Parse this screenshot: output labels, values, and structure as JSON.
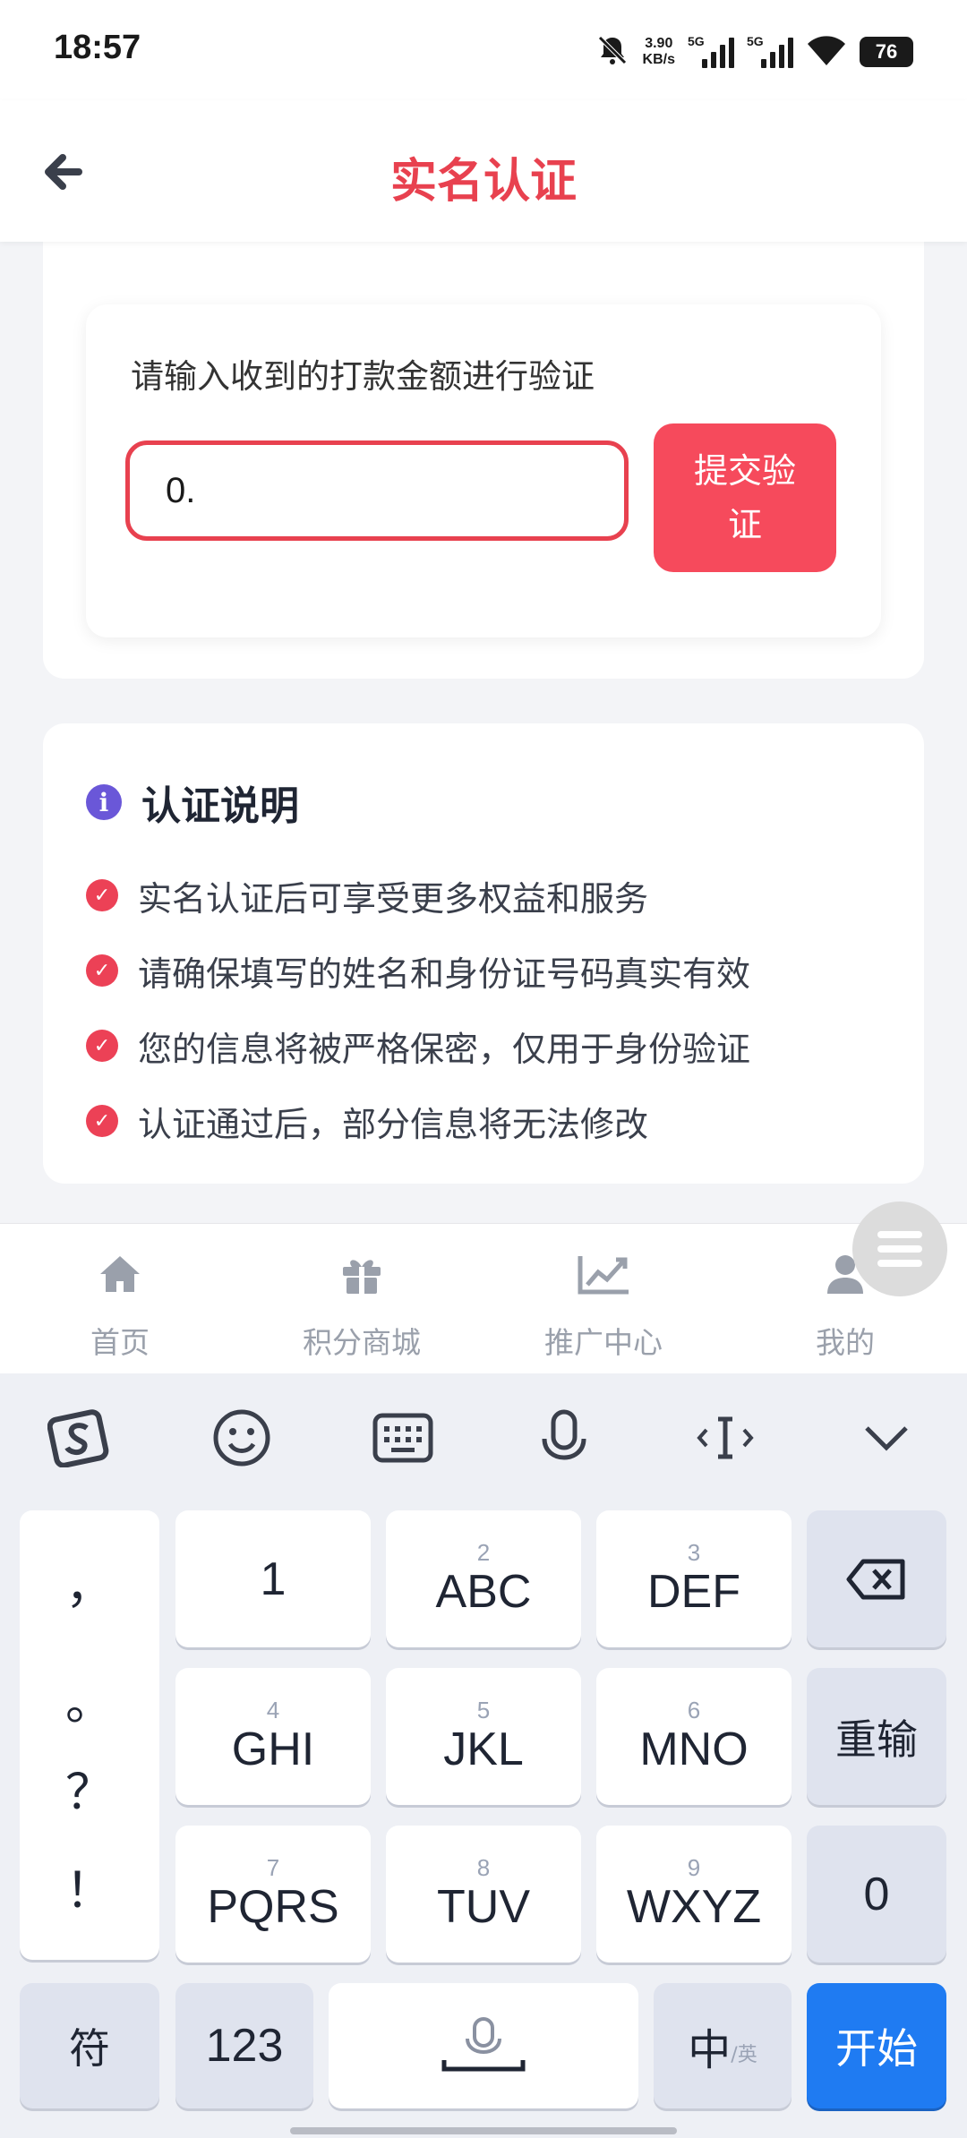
{
  "status_bar": {
    "time": "18:57",
    "net_speed_value": "3.90",
    "net_speed_unit": "KB/s",
    "sim1_label": "5G",
    "sim2_label": "5G",
    "battery": "76"
  },
  "header": {
    "title": "实名认证"
  },
  "verify": {
    "prompt": "请输入收到的打款金额进行验证",
    "amount_value": "0.",
    "submit_label": "提交验\n证"
  },
  "info": {
    "title": "认证说明",
    "items": [
      "实名认证后可享受更多权益和服务",
      "请确保填写的姓名和身份证号码真实有效",
      "您的信息将被严格保密，仅用于身份验证",
      "认证通过后，部分信息将无法修改"
    ]
  },
  "tabbar": {
    "items": [
      {
        "label": "首页",
        "icon": "home-icon"
      },
      {
        "label": "积分商城",
        "icon": "gift-icon"
      },
      {
        "label": "推广中心",
        "icon": "chart-icon"
      },
      {
        "label": "我的",
        "icon": "user-icon"
      }
    ]
  },
  "keyboard": {
    "punctuation": [
      "，",
      "。",
      "？",
      "！"
    ],
    "keys": [
      {
        "num": "",
        "letters": "1"
      },
      {
        "num": "2",
        "letters": "ABC"
      },
      {
        "num": "3",
        "letters": "DEF"
      },
      {
        "num": "4",
        "letters": "GHI"
      },
      {
        "num": "5",
        "letters": "JKL"
      },
      {
        "num": "6",
        "letters": "MNO"
      },
      {
        "num": "7",
        "letters": "PQRS"
      },
      {
        "num": "8",
        "letters": "TUV"
      },
      {
        "num": "9",
        "letters": "WXYZ"
      }
    ],
    "reset_label": "重输",
    "zero_label": "0",
    "symbol_label": "符",
    "num_label": "123",
    "lang_label": "中",
    "lang_sub": "/英",
    "go_label": "开始"
  },
  "colors": {
    "accent": "#e8414f",
    "button": "#f64a5c",
    "info_icon": "#6a57d8",
    "keyboard_go": "#1f7bf2"
  }
}
